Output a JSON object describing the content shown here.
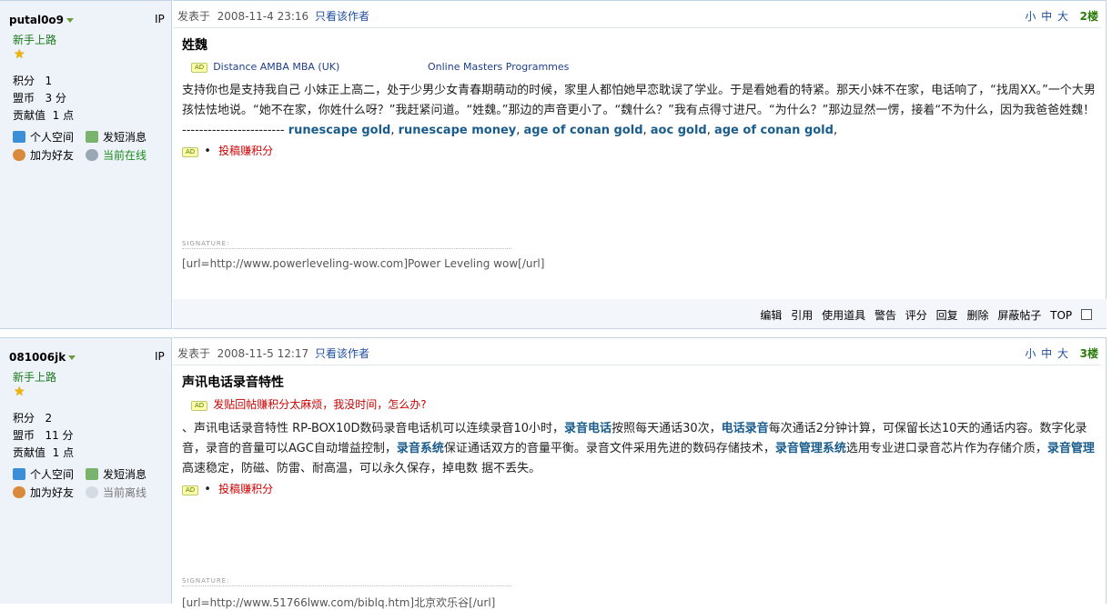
{
  "common": {
    "ip_label": "IP",
    "posted_at_label": "发表于",
    "only_author": "只看该作者",
    "font_sizes": "小 中 大",
    "stat_labels": {
      "credits": "积分",
      "coins": "盟币",
      "contribution": "贡献值"
    },
    "links": {
      "space": "个人空间",
      "pm": "发短消息",
      "friend": "加为好友"
    },
    "signature_label": "SIGNATURE:",
    "ad_badge": "AD"
  },
  "posts": [
    {
      "username": "putal0o9",
      "rank": "新手上路",
      "credits": "1",
      "coins": "3 分",
      "contribution": "1 点",
      "status": "当前在线",
      "date": "2008-11-4 23:16",
      "floor": "2楼",
      "title": "姓魏",
      "ads": [
        "Distance AMBA MBA (UK)",
        "Online Masters Programmes"
      ],
      "body_text": "支持你也是支持我自己 小妹正上高二，处于少男少女青春期萌动的时候，家里人都怕她早恋耽误了学业。于是看她看的特紧。那天小妹不在家，电话响了，“找周XX。”一个大男孩怯怯地说。“她不在家，你姓什么呀？”我赶紧问道。“姓魏。”那边的声音更小了。“魏什么？”我有点得寸进尺。“为什么？”那边显然一愣，接着“不为什么，因为我爸爸姓魏！  ------------------------",
      "keywords": [
        "runescape gold",
        "runescape money",
        "age of conan gold",
        "aoc gold",
        "age of conan gold"
      ],
      "bullet_link": "投稿赚积分",
      "signature": "[url=http://www.powerleveling-wow.com]Power Leveling wow[/url]",
      "actions": [
        "编辑",
        "引用",
        "使用道具",
        "警告",
        "评分",
        "回复",
        "删除",
        "屏蔽帖子",
        "TOP"
      ]
    },
    {
      "username": "081006jk",
      "rank": "新手上路",
      "credits": "2",
      "coins": "11 分",
      "contribution": "1 点",
      "status": "当前离线",
      "date": "2008-11-5 12:17",
      "floor": "3楼",
      "title": "声讯电话录音特性",
      "ad_text": "发贴回帖赚积分太麻烦，我没时间，怎么办?",
      "body": {
        "t1": "、声讯电话录音特性  RP-BOX10D数码录音电话机可以连续录音10小时，",
        "k1": "录音电话",
        "t2": "按照每天通话30次，",
        "k2": "电话录音",
        "t3": "每次通话2分钟计算，可保留长达10天的通话内容。数字化录音，录音的音量可以AGC自动增益控制，",
        "k3": "录音系统",
        "t4": "保证通话双方的音量平衡。录音文件采用先进的数码存储技术，",
        "k4": "录音管理系统",
        "t5": "选用专业进口录音芯片作为存储介质，",
        "k5": "录音管理",
        "t6": "  高速稳定，防磁、防雷、耐高温，可以永久保存，掉电数        据不丢失。"
      },
      "bullet_link": "投稿赚积分",
      "signature": "[url=http://www.51766lww.com/biblq.htm]北京欢乐谷[/url]"
    }
  ]
}
